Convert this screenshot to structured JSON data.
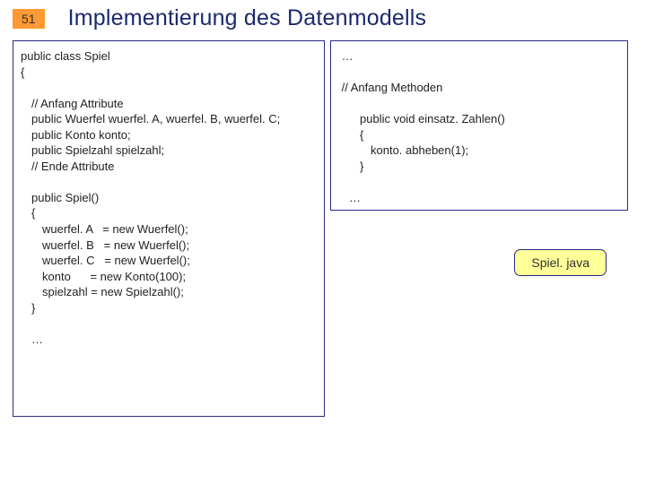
{
  "page_number": "51",
  "title": "Implementierung des Datenmodells",
  "file_badge": "Spiel. java",
  "left_code": [
    {
      "cls": "",
      "t": "public class Spiel"
    },
    {
      "cls": "",
      "t": "{"
    },
    {
      "cls": "",
      "t": ""
    },
    {
      "cls": "pad1",
      "t": "// Anfang Attribute"
    },
    {
      "cls": "pad1",
      "t": "public Wuerfel wuerfel. A, wuerfel. B, wuerfel. C;"
    },
    {
      "cls": "pad1",
      "t": "public Konto konto;"
    },
    {
      "cls": "pad1",
      "t": "public Spielzahl spielzahl;"
    },
    {
      "cls": "pad1",
      "t": "// Ende Attribute"
    },
    {
      "cls": "",
      "t": ""
    },
    {
      "cls": "pad1",
      "t": "public Spiel()"
    },
    {
      "cls": "pad1",
      "t": "{"
    },
    {
      "cls": "pad2",
      "t": "wuerfel. A   = new Wuerfel();"
    },
    {
      "cls": "pad2",
      "t": "wuerfel. B   = new Wuerfel();"
    },
    {
      "cls": "pad2",
      "t": "wuerfel. C   = new Wuerfel();"
    },
    {
      "cls": "pad2",
      "t": "konto      = new Konto(100);"
    },
    {
      "cls": "pad2",
      "t": "spielzahl = new Spielzahl();"
    },
    {
      "cls": "pad1",
      "t": "}"
    },
    {
      "cls": "",
      "t": ""
    },
    {
      "cls": "pad1",
      "t": "…"
    }
  ],
  "right_code": [
    {
      "cls": "",
      "t": " …"
    },
    {
      "cls": "",
      "t": ""
    },
    {
      "cls": "",
      "t": " // Anfang Methoden"
    },
    {
      "cls": "",
      "t": ""
    },
    {
      "cls": "pad2",
      "t": "public void einsatz. Zahlen()"
    },
    {
      "cls": "pad2",
      "t": "{"
    },
    {
      "cls": "pad3",
      "t": "konto. abheben(1);"
    },
    {
      "cls": "pad2",
      "t": "}"
    },
    {
      "cls": "",
      "t": ""
    },
    {
      "cls": "pad1",
      "t": "…"
    }
  ]
}
